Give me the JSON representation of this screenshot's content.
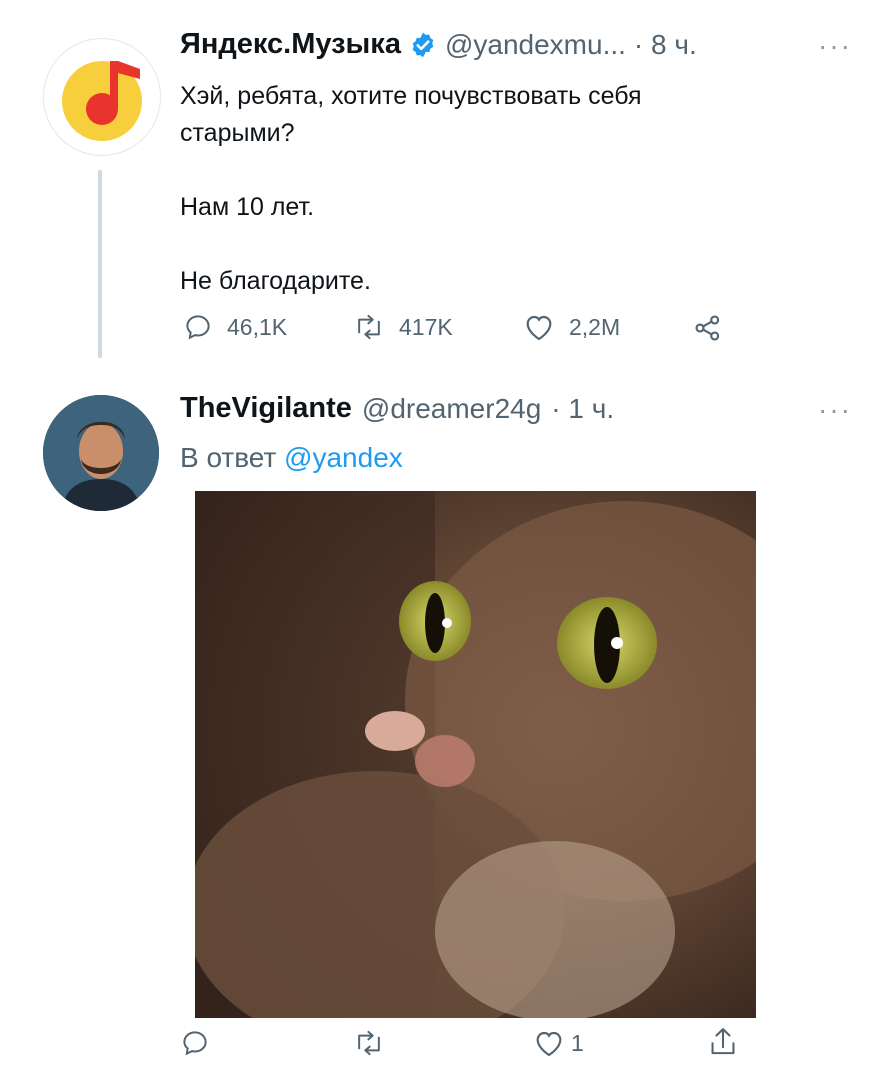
{
  "tweets": [
    {
      "name": "Яндекс.Музыка",
      "handle": "@yandexmu...",
      "time": "· 8 ч.",
      "text_lines": [
        "Хэй, ребята, хотите почувствовать себя",
        "старыми?",
        "",
        "Нам 10 лет.",
        "",
        "Не благодарите."
      ],
      "verified": true,
      "avatar_icon": "yandex-music-logo",
      "actions": {
        "replies": "46,1K",
        "retweets": "417K",
        "likes": "2,2M"
      }
    },
    {
      "name": "TheVigilante",
      "handle": "@dreamer24g",
      "time": "· 1 ч.",
      "reply_prefix": "В ответ",
      "reply_to": "@yandex",
      "avatar_icon": "user-avatar-portrait",
      "media": "cat-photo",
      "actions": {
        "replies": "",
        "retweets": "",
        "likes": "1"
      }
    }
  ],
  "colors": {
    "accent": "#1d9bf0",
    "muted": "#536471",
    "yandex_yellow": "#f7cf3d",
    "yandex_red": "#e8342c"
  }
}
